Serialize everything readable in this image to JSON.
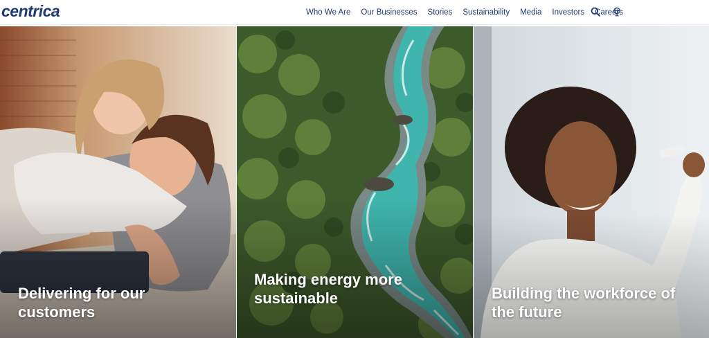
{
  "brand": {
    "logo_text": "centrica",
    "color": "#1f3b73"
  },
  "nav": {
    "items": [
      {
        "label": "Who We Are"
      },
      {
        "label": "Our Businesses"
      },
      {
        "label": "Stories"
      },
      {
        "label": "Sustainability"
      },
      {
        "label": "Media"
      },
      {
        "label": "Investors"
      },
      {
        "label": "Careers"
      }
    ],
    "icons": [
      "search-icon",
      "globe-icon"
    ]
  },
  "panels": [
    {
      "title_line1": "Delivering for our",
      "title_line2": "customers",
      "image": "mother-and-child-with-tablet"
    },
    {
      "title_line1": "Making energy more",
      "title_line2": "sustainable",
      "image": "aerial-forest-river"
    },
    {
      "title_line1": "Building the workforce of",
      "title_line2": "the future",
      "image": "woman-writing-on-whiteboard"
    }
  ]
}
